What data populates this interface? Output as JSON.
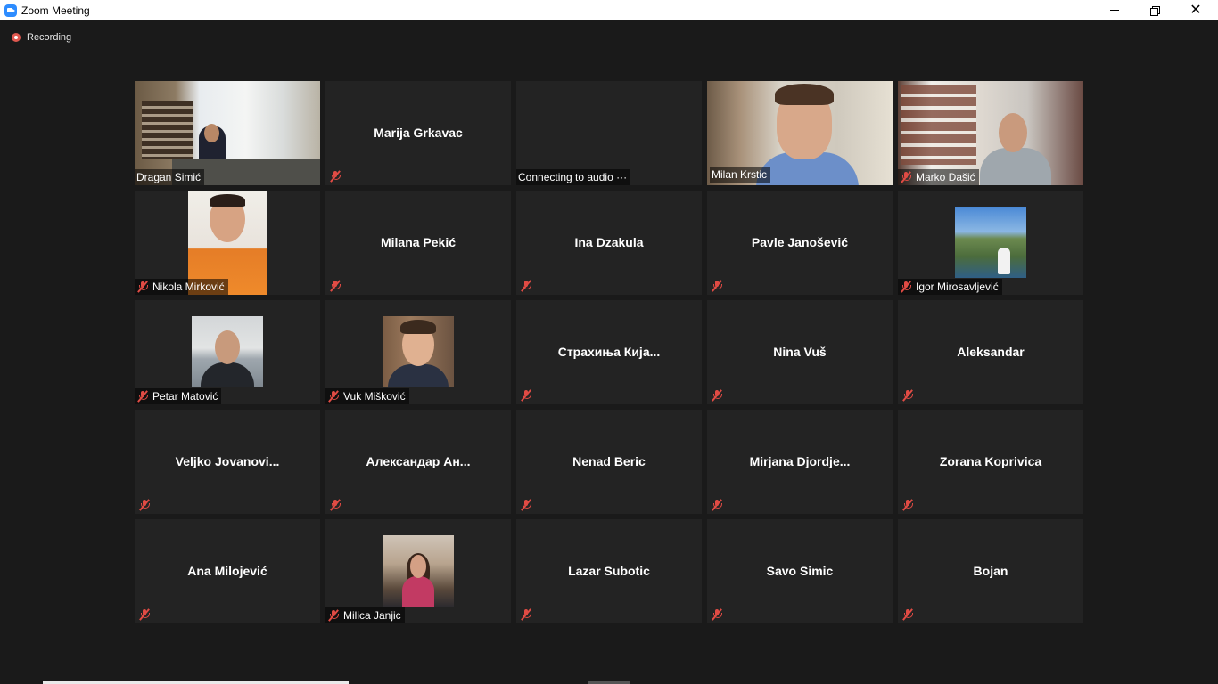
{
  "window": {
    "title": "Zoom Meeting",
    "minimize_icon": "minimize-icon",
    "restore_icon": "restore-icon",
    "close_label": "✕"
  },
  "recording": {
    "label": "Recording"
  },
  "colors": {
    "active_speaker_border": "#cfe17a",
    "muted_icon": "#e04b44",
    "tile_bg": "#232323",
    "recording_dot": "#e0584f"
  },
  "participants": [
    {
      "name": "Dragan Simić",
      "muted": false,
      "video": true
    },
    {
      "name": "Marija Grkavac",
      "muted": true,
      "video": false
    },
    {
      "name": "Connecting to audio ···",
      "muted": false,
      "video": false
    },
    {
      "name": "Milan Krstic",
      "muted": false,
      "video": true,
      "active": true
    },
    {
      "name": "Marko Dašić",
      "muted": true,
      "video": true
    },
    {
      "name": "Nikola Mirković",
      "muted": true,
      "video": false,
      "avatar": true
    },
    {
      "name": "Milana Pekić",
      "muted": true,
      "video": false
    },
    {
      "name": "Ina Dzakula",
      "muted": true,
      "video": false
    },
    {
      "name": "Pavle Janošević",
      "muted": true,
      "video": false
    },
    {
      "name": "Igor Mirosavljević",
      "muted": true,
      "video": false,
      "avatar": true
    },
    {
      "name": "Petar Matović",
      "muted": true,
      "video": false,
      "avatar": true
    },
    {
      "name": "Vuk Mišković",
      "muted": true,
      "video": false,
      "avatar": true
    },
    {
      "name": "Страхиња Кија...",
      "muted": true,
      "video": false
    },
    {
      "name": "Nina Vuš",
      "muted": true,
      "video": false
    },
    {
      "name": "Aleksandar",
      "muted": true,
      "video": false
    },
    {
      "name": "Veljko  Jovanovi...",
      "muted": true,
      "video": false
    },
    {
      "name": "Александар  Ан...",
      "muted": true,
      "video": false
    },
    {
      "name": "Nenad Beric",
      "muted": true,
      "video": false
    },
    {
      "name": "Mirjana  Djordje...",
      "muted": true,
      "video": false
    },
    {
      "name": "Zorana Koprivica",
      "muted": true,
      "video": false
    },
    {
      "name": "Ana Milojević",
      "muted": true,
      "video": false
    },
    {
      "name": "Milica Janjic",
      "muted": true,
      "video": false,
      "avatar": true
    },
    {
      "name": "Lazar Subotic",
      "muted": true,
      "video": false
    },
    {
      "name": "Savo Simic",
      "muted": true,
      "video": false
    },
    {
      "name": "Bojan",
      "muted": true,
      "video": false
    }
  ]
}
